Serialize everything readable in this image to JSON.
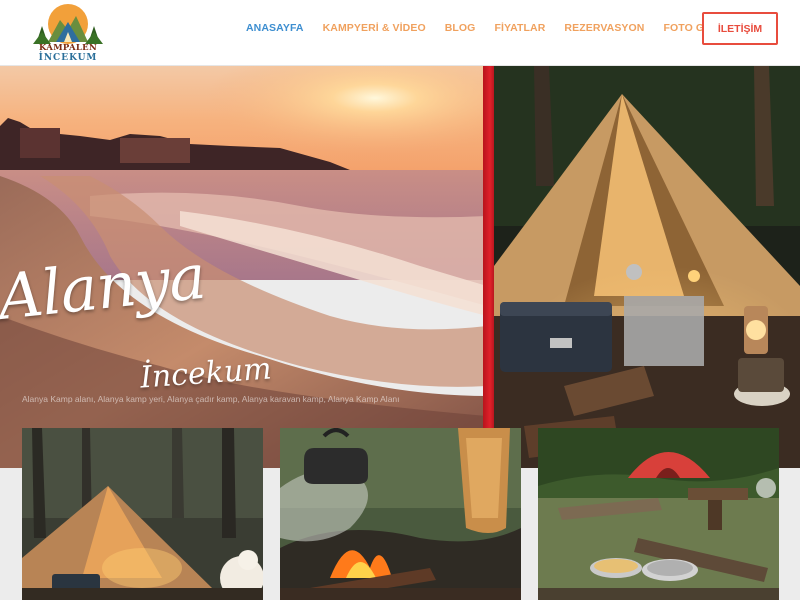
{
  "logo": {
    "line1": "KAMPALEN",
    "line2": "İNCEKUM"
  },
  "nav": {
    "items": [
      {
        "label": "ANASAYFA",
        "active": true
      },
      {
        "label": "KAMPYERİ & VİDEO",
        "active": false
      },
      {
        "label": "BLOG",
        "active": false
      },
      {
        "label": "FİYATLAR",
        "active": false
      },
      {
        "label": "REZERVASYON",
        "active": false
      },
      {
        "label": "FOTO GALERİ",
        "active": false
      }
    ],
    "contact_label": "İLETİŞİM"
  },
  "hero": {
    "title_line1": "Alanya",
    "title_line2": "İncekum",
    "caption": "Alanya Kamp alanı, Alanya kamp yeri, Alanya çadır kamp, Alanya karavan kamp, Alanya Kamp Alanı"
  },
  "gallery": {
    "items": [
      {
        "icon": "tent-photo"
      },
      {
        "icon": "campfire-photo"
      },
      {
        "icon": "forest-camp-photo"
      }
    ]
  },
  "colors": {
    "nav_active": "#3d8ed0",
    "nav_default": "#f0a15e",
    "contact_border": "#e84c3d",
    "hero_divider": "#e0212a"
  }
}
